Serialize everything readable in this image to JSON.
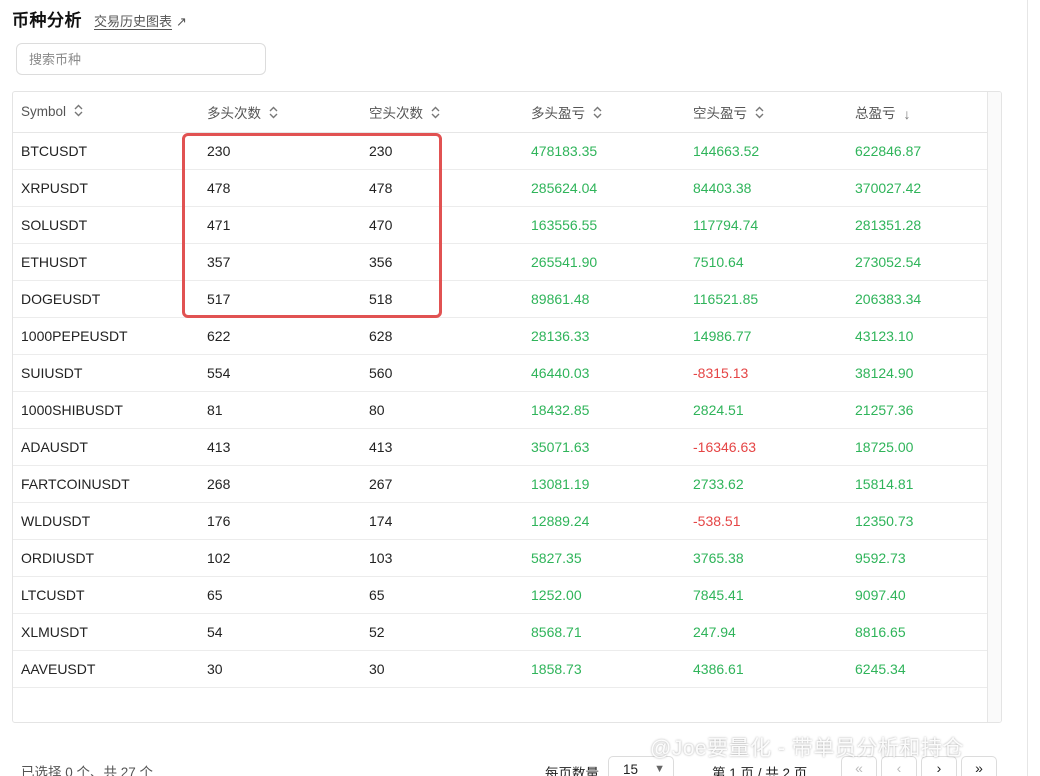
{
  "header": {
    "title": "币种分析",
    "history_link": "交易历史图表",
    "history_link_icon": "↗"
  },
  "search": {
    "placeholder": "搜索币种",
    "value": ""
  },
  "table": {
    "columns": [
      {
        "label": "Symbol",
        "sort": "unsorted"
      },
      {
        "label": "多头次数",
        "sort": "unsorted"
      },
      {
        "label": "空头次数",
        "sort": "unsorted"
      },
      {
        "label": "多头盈亏",
        "sort": "unsorted"
      },
      {
        "label": "空头盈亏",
        "sort": "unsorted"
      },
      {
        "label": "总盈亏",
        "sort": "descending"
      }
    ],
    "rows": [
      [
        "BTCUSDT",
        "230",
        "230",
        "478183.35",
        "144663.52",
        "622846.87"
      ],
      [
        "XRPUSDT",
        "478",
        "478",
        "285624.04",
        "84403.38",
        "370027.42"
      ],
      [
        "SOLUSDT",
        "471",
        "470",
        "163556.55",
        "117794.74",
        "281351.28"
      ],
      [
        "ETHUSDT",
        "357",
        "356",
        "265541.90",
        "7510.64",
        "273052.54"
      ],
      [
        "DOGEUSDT",
        "517",
        "518",
        "89861.48",
        "116521.85",
        "206383.34"
      ],
      [
        "1000PEPEUSDT",
        "622",
        "628",
        "28136.33",
        "14986.77",
        "43123.10"
      ],
      [
        "SUIUSDT",
        "554",
        "560",
        "46440.03",
        "-8315.13",
        "38124.90"
      ],
      [
        "1000SHIBUSDT",
        "81",
        "80",
        "18432.85",
        "2824.51",
        "21257.36"
      ],
      [
        "ADAUSDT",
        "413",
        "413",
        "35071.63",
        "-16346.63",
        "18725.00"
      ],
      [
        "FARTCOINUSDT",
        "268",
        "267",
        "13081.19",
        "2733.62",
        "15814.81"
      ],
      [
        "WLDUSDT",
        "176",
        "174",
        "12889.24",
        "-538.51",
        "12350.73"
      ],
      [
        "ORDIUSDT",
        "102",
        "103",
        "5827.35",
        "3765.38",
        "9592.73"
      ],
      [
        "LTCUSDT",
        "65",
        "65",
        "1252.00",
        "7845.41",
        "9097.40"
      ],
      [
        "XLMUSDT",
        "54",
        "52",
        "8568.71",
        "247.94",
        "8816.65"
      ],
      [
        "AAVEUSDT",
        "30",
        "30",
        "1858.73",
        "4386.61",
        "6245.34"
      ]
    ]
  },
  "footer": {
    "selection_status": "已选择 0 个、共 27 个",
    "page_size_label": "每页数量",
    "page_size_value": "15",
    "page_info": "第 1 页 / 共 2 页",
    "pager": {
      "first": "«",
      "prev": "‹",
      "next": "›",
      "last": "»"
    }
  },
  "colors": {
    "positive": "#2fb45a",
    "negative": "#e54545",
    "highlight": "#e15252"
  },
  "watermark": "@Joe要量化 - 带单员分析和持仓"
}
